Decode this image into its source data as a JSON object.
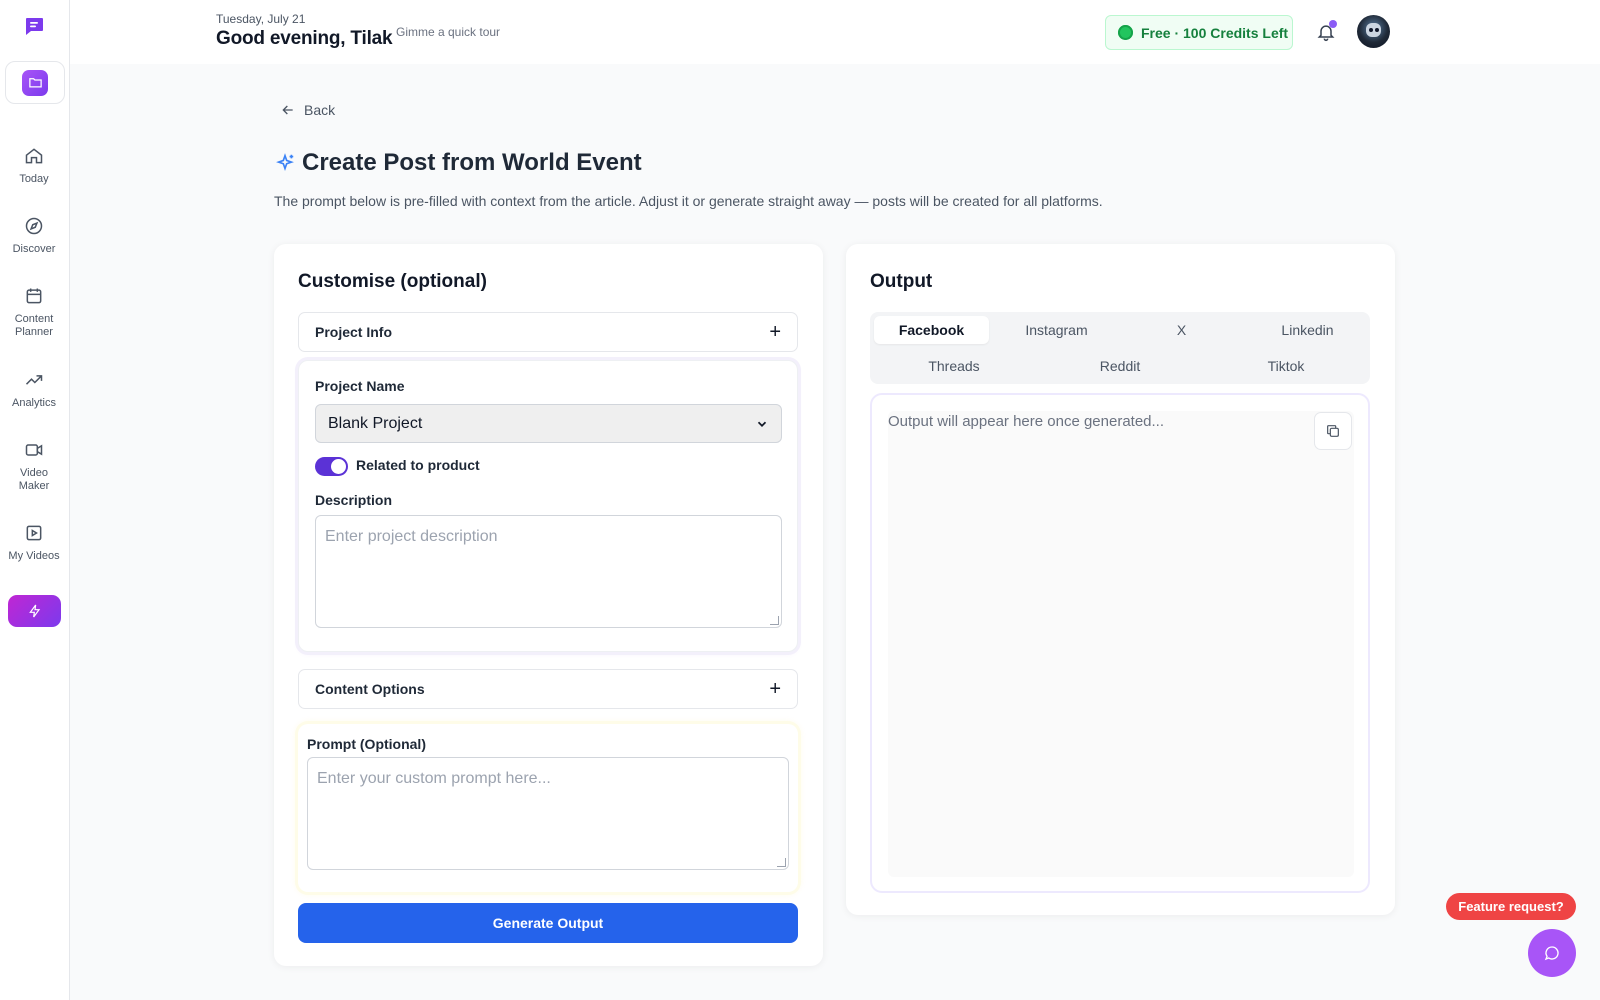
{
  "sidebar": {
    "logo_icon": "chat-logo-icon",
    "project_icon": "folder-icon",
    "items": [
      {
        "label": "Today",
        "icon": "home-icon"
      },
      {
        "label": "Discover",
        "icon": "compass-icon"
      },
      {
        "label": "Content Planner",
        "icon": "calendar-icon"
      },
      {
        "label": "Analytics",
        "icon": "trending-up-icon"
      },
      {
        "label": "Video Maker",
        "icon": "video-icon"
      },
      {
        "label": "My Videos",
        "icon": "play-square-icon"
      }
    ],
    "upgrade_icon": "bolt-icon"
  },
  "header": {
    "date": "Tuesday, July 21",
    "greeting": "Good evening, Tilak",
    "tour_link": "Gimme a quick tour",
    "credits": "Free · 100 Credits Left",
    "credits_color": "#15803d",
    "bell_icon": "bell-icon"
  },
  "page": {
    "back_label": "Back",
    "title": "Create Post from World Event",
    "title_icon": "sparkles-icon",
    "subtitle": "The prompt below is pre-filled with context from the article. Adjust it or generate straight away — posts will be created for all platforms."
  },
  "customise": {
    "title": "Customise (optional)",
    "project_info_label": "Project Info",
    "project_name_label": "Project Name",
    "project_name_value": "Blank Project",
    "related_label": "Related to product",
    "related_enabled": true,
    "description_label": "Description",
    "description_placeholder": "Enter project description",
    "content_options_label": "Content Options",
    "prompt_label": "Prompt (Optional)",
    "prompt_placeholder": "Enter your custom prompt here...",
    "generate_label": "Generate Output",
    "accent": "#2563eb"
  },
  "output": {
    "title": "Output",
    "tabs": [
      "Facebook",
      "Instagram",
      "X",
      "Linkedin",
      "Threads",
      "Reddit",
      "Tiktok"
    ],
    "active_tab": "Facebook",
    "placeholder": "Output will appear here once generated...",
    "copy_icon": "copy-icon"
  },
  "floating": {
    "feature_request": "Feature request?",
    "chat_icon": "chat-bubble-icon"
  }
}
